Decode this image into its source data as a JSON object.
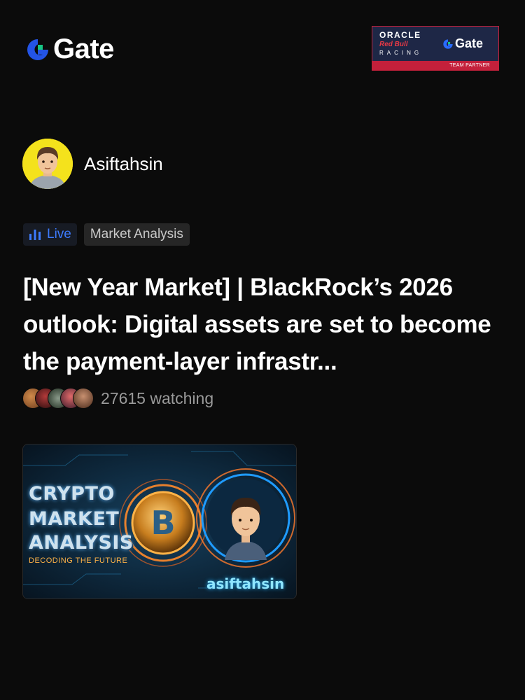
{
  "brand": {
    "name": "Gate",
    "icon": "gate-g-icon",
    "accent": "#2354e6",
    "accent_light": "#16c784"
  },
  "partner_badge": {
    "line1": "ORACLE",
    "line2": "Red Bull",
    "line3": "RACING",
    "gate": "Gate",
    "caption": "TEAM PARTNER"
  },
  "author": {
    "name": "Asiftahsin",
    "avatar": "avatar-illustration"
  },
  "tags": {
    "live_label": "Live",
    "live_icon": "bar-chart-icon",
    "category": "Market Analysis",
    "live_color": "#3d7bff"
  },
  "post": {
    "title": "[New Year Market] | BlackRock’s 2026 outlook: Digital assets are set to become the payment-layer infrastr..."
  },
  "watchers": {
    "count_text": "27615 watching",
    "avatar_count": 5
  },
  "thumbnail": {
    "line1": "CRYPTO",
    "line2": "MARKET",
    "line3": "ANALYSIS",
    "subtitle": "DECODING THE FUTURE",
    "handle": "asiftahsin",
    "coin_symbol": "B"
  }
}
